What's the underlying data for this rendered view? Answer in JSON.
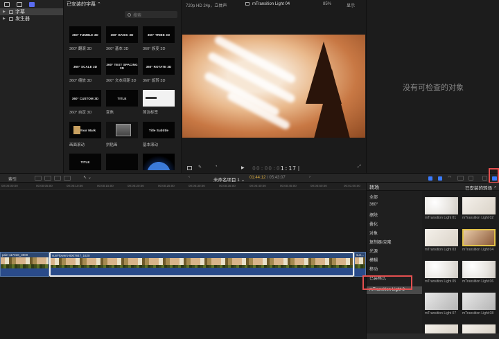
{
  "sidebar": {
    "items": [
      {
        "label": "字幕"
      },
      {
        "label": "发生器"
      }
    ]
  },
  "browser": {
    "header": "已安装的字幕 ⌃",
    "search_placeholder": "搜索",
    "items": [
      {
        "thumb": "360° TUMBLE 3D",
        "label": "360° 翻滚 3D"
      },
      {
        "thumb": "360° BASIC 3D",
        "label": "360° 基本 3D"
      },
      {
        "thumb": "360° TRIBE 3D",
        "label": "360° 族变 3D"
      },
      {
        "thumb": "360° SCALE 3D",
        "label": "360° 缩放 3D"
      },
      {
        "thumb": "360° TEXT SPACING 3D",
        "label": "360° 文本间距 3D"
      },
      {
        "thumb": "360° ROTATE 3D",
        "label": "360° 旋转 3D"
      },
      {
        "thumb": "360° CUSTOM 3D",
        "label": "360° 自定 3D"
      },
      {
        "thumb": "TITLE",
        "label": "变焦"
      },
      {
        "thumb": "",
        "label": "简洁标签"
      },
      {
        "thumb": "On Your Mark",
        "label": "画面滚动"
      },
      {
        "thumb": "",
        "label": "拼贴画"
      },
      {
        "thumb": "Title Subtitle",
        "label": "基本滚动"
      },
      {
        "thumb": "TITLE",
        "label": ""
      },
      {
        "thumb": "",
        "label": ""
      },
      {
        "thumb": "",
        "label": ""
      }
    ]
  },
  "viewer": {
    "format": "720p HD 24p，立体声",
    "clip_title": "mTransition Light 04",
    "zoom": "85%",
    "view_menu": "显示",
    "timecode_dim": "00:00:0",
    "timecode_lit": "1:17"
  },
  "inspector": {
    "empty_message": "没有可检查的对象"
  },
  "timeline_bar": {
    "library_label": "索引",
    "project_name": "未命名项目 1 ⌄",
    "current_time": "01:44:12",
    "duration": "/ 05:43:07"
  },
  "ruler": [
    "00:00:00:00",
    "00:00:05:00",
    "00:00:10:00",
    "00:00:15:00",
    "00:00:20:00",
    "00:00:25:00",
    "00:00:30:00",
    "00:00:35:00",
    "00:00:40:00",
    "00:00:45:00",
    "00:00:50:00",
    "00:01:00:00"
  ],
  "clips": {
    "left_name": "pain-117018_3800",
    "main_name": "sunFlowers-8007847_1620",
    "right_name": "sun..."
  },
  "transitions": {
    "title": "转场",
    "installed_label": "已安装的转场 ⌃",
    "categories": [
      "全部",
      "360°",
      "擦除",
      "叠化",
      "对象",
      "复制器/克隆",
      "光源",
      "模糊",
      "移动",
      "已装格式",
      "mTransition Light 2"
    ],
    "selected_category_index": 10,
    "items": [
      {
        "label": "mTransition Light 01"
      },
      {
        "label": "mTransition Light 02"
      },
      {
        "label": "mTransition Light 03"
      },
      {
        "label": "mTransition Light 04"
      },
      {
        "label": "mTransition Light 05"
      },
      {
        "label": "mTransition Light 06"
      },
      {
        "label": "mTransition Light 07"
      },
      {
        "label": "mTransition Light 08"
      }
    ],
    "selected_item_index": 3
  },
  "colors": {
    "accent_blue": "#3a7bff",
    "highlight_red": "#e55050",
    "timecode_orange": "#d6a940",
    "selection_yellow": "#e3c34a"
  }
}
